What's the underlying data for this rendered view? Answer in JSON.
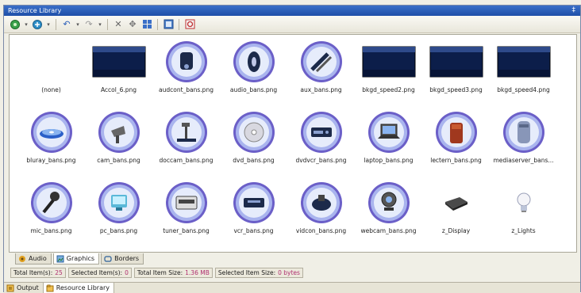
{
  "window": {
    "title": "Resource Library",
    "pin": "‡"
  },
  "toolbar": {
    "buttons": [
      "add-library-icon",
      "add-library-dropdown",
      "undo-icon",
      "undo-dropdown",
      "redo-icon",
      "redo-dropdown",
      "delete-icon",
      "move-icon",
      "thumbnail-view-icon",
      "list-view-icon",
      "refresh-icon"
    ]
  },
  "items": [
    {
      "name": "(none)",
      "icon": "none"
    },
    {
      "name": "Accol_6.png",
      "icon": "dark-panel"
    },
    {
      "name": "audcont_bans.png",
      "icon": "audio-controller"
    },
    {
      "name": "audio_bans.png",
      "icon": "audio-speaker"
    },
    {
      "name": "aux_bans.png",
      "icon": "aux-cable"
    },
    {
      "name": "bkgd_speed2.png",
      "icon": "dark-panel"
    },
    {
      "name": "bkgd_speed3.png",
      "icon": "dark-panel"
    },
    {
      "name": "bkgd_speed4.png",
      "icon": "dark-panel"
    },
    {
      "name": "bluray_bans.png",
      "icon": "bluray-disc"
    },
    {
      "name": "cam_bans.png",
      "icon": "camera"
    },
    {
      "name": "doccam_bans.png",
      "icon": "document-camera"
    },
    {
      "name": "dvd_bans.png",
      "icon": "dvd-disc"
    },
    {
      "name": "dvdvcr_bans.png",
      "icon": "dvd-vcr"
    },
    {
      "name": "laptop_bans.png",
      "icon": "laptop"
    },
    {
      "name": "lectern_bans.png",
      "icon": "lectern"
    },
    {
      "name": "mediaserver_bans...",
      "icon": "media-server"
    },
    {
      "name": "mic_bans.png",
      "icon": "microphone"
    },
    {
      "name": "pc_bans.png",
      "icon": "pc"
    },
    {
      "name": "tuner_bans.png",
      "icon": "tuner"
    },
    {
      "name": "vcr_bans.png",
      "icon": "vcr"
    },
    {
      "name": "vidcon_bans.png",
      "icon": "video-conference"
    },
    {
      "name": "webcam_bans.png",
      "icon": "webcam"
    },
    {
      "name": "z_Display",
      "icon": "display"
    },
    {
      "name": "z_Lights",
      "icon": "lightbulb"
    }
  ],
  "tabs": [
    {
      "label": "Audio",
      "icon": "audio-tab-icon"
    },
    {
      "label": "Graphics",
      "icon": "graphics-tab-icon",
      "active": true
    },
    {
      "label": "Borders",
      "icon": "borders-tab-icon"
    }
  ],
  "status": {
    "total_items_label": "Total Item(s):",
    "total_items_value": "25",
    "selected_items_label": "Selected Item(s):",
    "selected_items_value": "0",
    "total_size_label": "Total Item Size:",
    "total_size_value": "1.36 MB",
    "selected_size_label": "Selected Item Size:",
    "selected_size_value": "0 bytes"
  },
  "bottom_tabs": [
    {
      "label": "Output",
      "icon": "output-icon"
    },
    {
      "label": "Resource Library",
      "icon": "resource-library-icon",
      "active": true
    }
  ],
  "colors": {
    "accent": "#2b5fb8",
    "icon_ring": "#7a6fd0",
    "status_value": "#b03070"
  }
}
